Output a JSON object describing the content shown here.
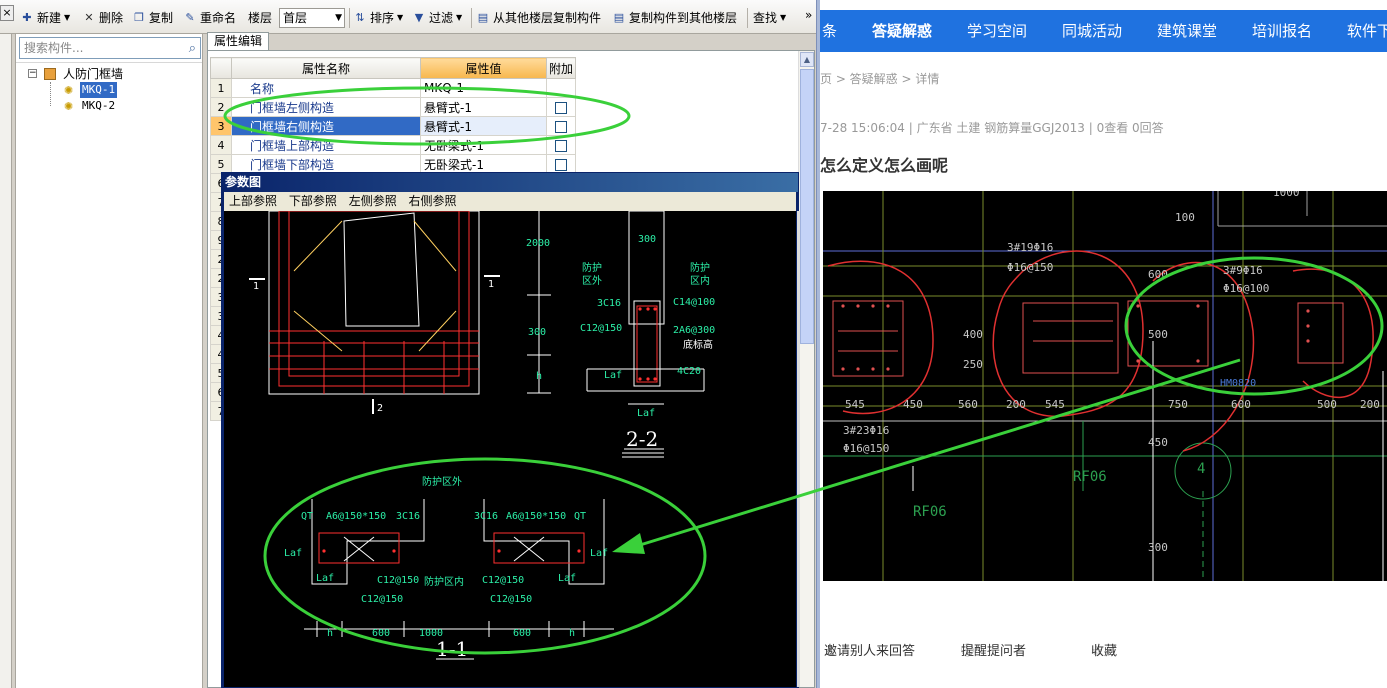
{
  "toolbar": {
    "close": "×",
    "new": "新建",
    "delete": "删除",
    "copy": "复制",
    "rename": "重命名",
    "floor_label": "楼层",
    "floor_value": "首层",
    "sort": "排序",
    "filter": "过滤",
    "copy_from_floor": "从其他楼层复制构件",
    "copy_to_floor": "复制构件到其他楼层",
    "find": "查找",
    "more": "»"
  },
  "tree": {
    "search_placeholder": "搜索构件...",
    "root": "人防门框墙",
    "items": [
      "MKQ-1",
      "MKQ-2"
    ]
  },
  "props": {
    "tab": "属性编辑",
    "headers": [
      "属性名称",
      "属性值",
      "附加"
    ],
    "rows": [
      {
        "num": "1",
        "name": "名称",
        "value": "MKQ-1"
      },
      {
        "num": "2",
        "name": "门框墙左侧构造",
        "value": "悬臂式-1"
      },
      {
        "num": "3",
        "name": "门框墙右侧构造",
        "value": "悬臂式-1"
      },
      {
        "num": "4",
        "name": "门框墙上部构造",
        "value": "无卧梁式-1"
      },
      {
        "num": "5",
        "name": "门框墙下部构造",
        "value": "无卧梁式-1"
      }
    ],
    "hidden_rows": [
      "6",
      "7",
      "8",
      "9",
      "2",
      "2",
      "3",
      "3",
      "4",
      "4",
      "5",
      "6",
      "7"
    ]
  },
  "param_window": {
    "title": "参数图",
    "menu": [
      "上部参照",
      "下部参照",
      "左侧参照",
      "右侧参照"
    ],
    "cad": {
      "dims": [
        "2000",
        "300",
        "h",
        "1000",
        "600",
        "600",
        "h",
        "h",
        "300"
      ],
      "labels": {
        "outside_a": "防护",
        "outside_b": "区外",
        "inside_a": "防护",
        "inside_b": "区内",
        "c1": "3C16",
        "c2": "C14@100",
        "c3": "C12@150",
        "c4": "2A6@300",
        "c5": "底标高",
        "c6": "4C20",
        "laf": "Laf",
        "sec22": "2-2",
        "sec11": "1-1",
        "mark1": "1",
        "mark2": "2",
        "zone_out": "防护区外",
        "zone_in": "防护区内",
        "qt": "QT",
        "a6": "A6@150*150",
        "c16": "3C16",
        "c12": "C12@150"
      }
    }
  },
  "web": {
    "nav": [
      "条",
      "答疑解惑",
      "学习空间",
      "同城活动",
      "建筑课堂",
      "培训报名",
      "软件下"
    ],
    "nav_active": 1,
    "breadcrumb": "页 > 答疑解惑 > 详情",
    "meta": "7-28 15:06:04    |    广东省  土建  钢筋算量GGJ2013    |    0查看  0回答",
    "question_title": "怎么定义怎么画呢",
    "photo_labels": {
      "l1": "3#19Φ16",
      "l2": "Φ16@150",
      "l3": "3#9Φ16",
      "l4": "Φ16@100",
      "l5": "3#23Φ16",
      "l6": "Φ16@150",
      "d1": "545",
      "d2": "450",
      "d3": "560",
      "d4": "200",
      "d5": "545",
      "d6": "750",
      "d7": "600",
      "d8": "500",
      "d9": "200",
      "v1": "400",
      "v2": "250",
      "v3": "500",
      "v4": "600",
      "v5": "1000",
      "v6": "300",
      "v7": "450",
      "v8": "100",
      "rf": "RF06",
      "hm": "HM0820",
      "c4": "4"
    },
    "actions": [
      "邀请别人来回答",
      "提醒提问者",
      "收藏"
    ]
  }
}
